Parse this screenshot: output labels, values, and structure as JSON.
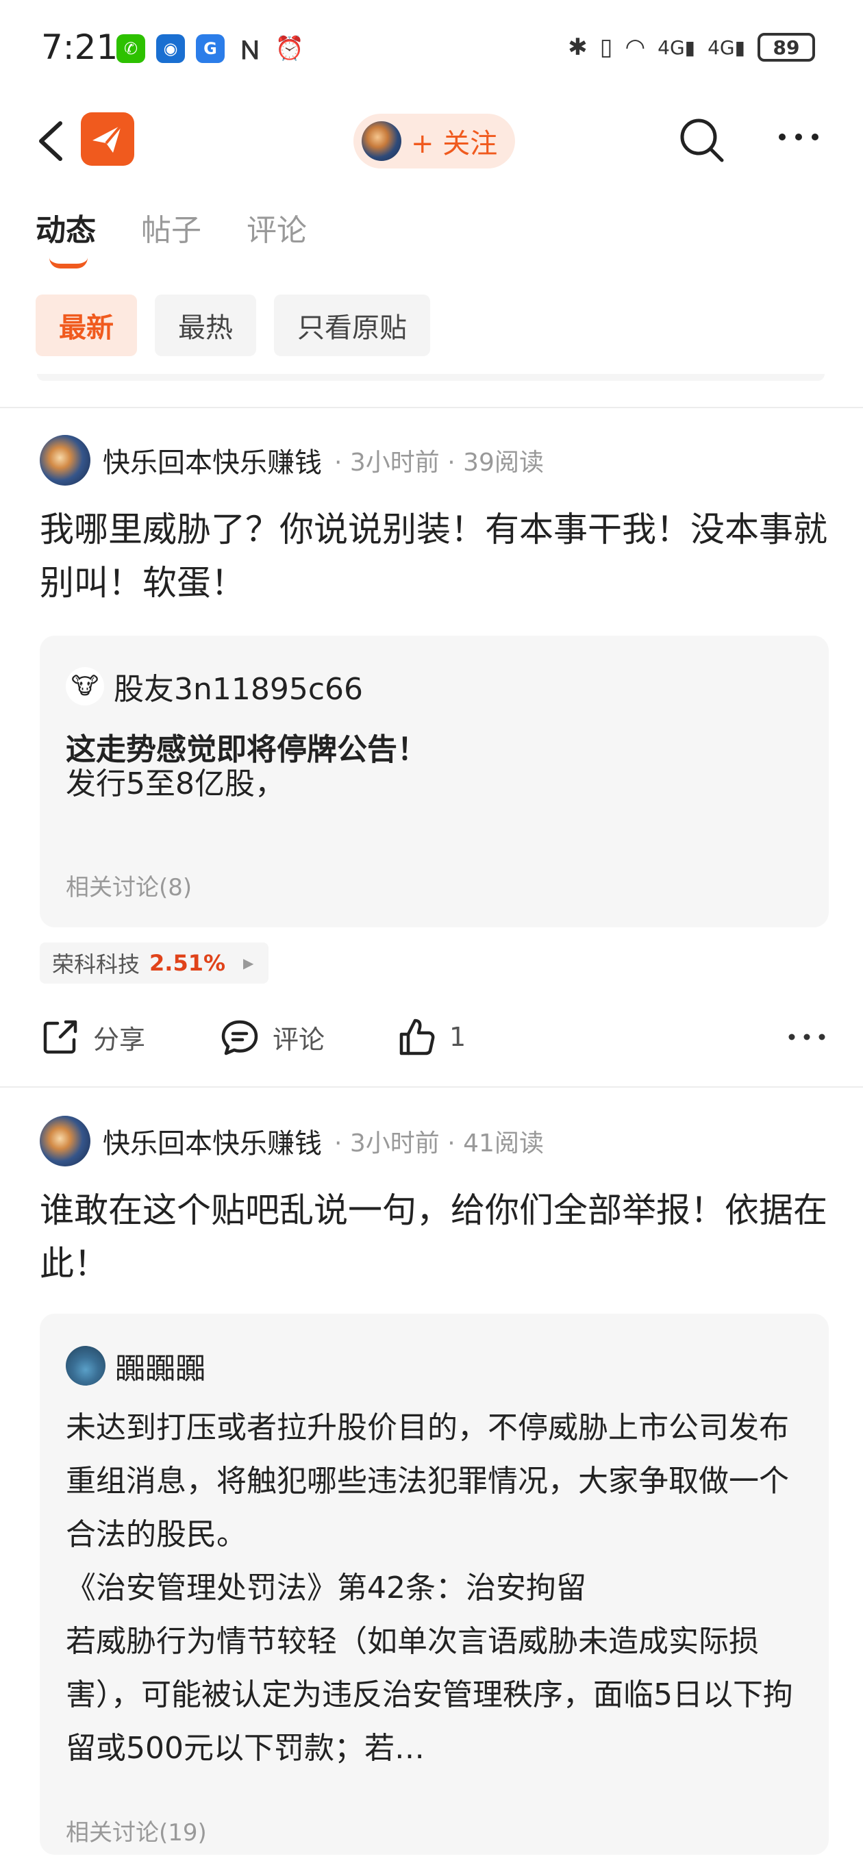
{
  "status_bar": {
    "time": "7:21",
    "battery": "89",
    "apps": [
      {
        "name": "wechat-icon",
        "color": "#2dc100",
        "glyph": "✆"
      },
      {
        "name": "bank-icon",
        "color": "#1a6fd1",
        "glyph": "◉"
      },
      {
        "name": "browser-icon",
        "color": "#2b7de9",
        "glyph": "G"
      },
      {
        "name": "nfc-icon",
        "color": "#333333",
        "glyph": "N"
      },
      {
        "name": "alarm-icon",
        "color": "#333333",
        "glyph": "⏰"
      }
    ],
    "right_icons": [
      "bluetooth-icon",
      "vibrate-icon",
      "wifi-icon",
      "signal-4g-icon",
      "signal-4g-icon"
    ]
  },
  "header": {
    "follow_label": "+ 关注",
    "accent": "#f05a1e"
  },
  "tabs": [
    {
      "label": "动态",
      "active": true
    },
    {
      "label": "帖子",
      "active": false
    },
    {
      "label": "评论",
      "active": false
    }
  ],
  "filters": [
    {
      "label": "最新",
      "active": true
    },
    {
      "label": "最热",
      "active": false
    },
    {
      "label": "只看原贴",
      "active": false
    }
  ],
  "posts": [
    {
      "author": "快乐回本快乐赚钱",
      "time": "3小时前",
      "reads": "39阅读",
      "text": "我哪里威胁了？你说说别装！有本事干我！没本事就别叫！软蛋！",
      "quote": {
        "author": "股友3n11895c66",
        "title": "这走势感觉即将停牌公告！",
        "body": "发行5至8亿股，",
        "related": "相关讨论(8)"
      },
      "stock": {
        "name": "荣科科技",
        "change": "2.51%"
      },
      "share_label": "分享",
      "comment_label": "评论",
      "like_count": "1"
    },
    {
      "author": "快乐回本快乐赚钱",
      "time": "3小时前",
      "reads": "41阅读",
      "text": "谁敢在这个贴吧乱说一句，给你们全部举报！依据在此！",
      "quote": {
        "author": "嚻嚻嚻",
        "body": "未达到打压或者拉升股价目的，不停威胁上市公司发布重组消息，将触犯哪些违法犯罪情况，大家争取做一个合法的股民。\n《治安管理处罚法》第42条：治安拘留\n若威胁行为情节较轻（如单次言语威胁未造成实际损害），可能被认定为违反治安管理秩序，面临5日以下拘留或500元以下罚款；若…",
        "related": "相关讨论(19)"
      }
    }
  ]
}
